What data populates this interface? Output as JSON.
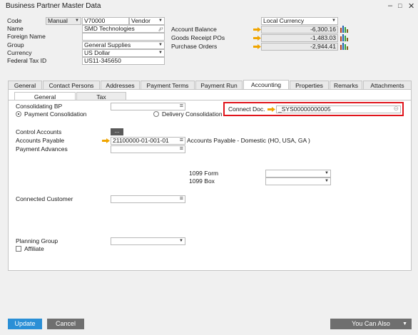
{
  "window": {
    "title": "Business Partner Master Data"
  },
  "header": {
    "code_label": "Code",
    "code_series": "Manual",
    "code_value": "V70000",
    "bp_type": "Vendor",
    "name_label": "Name",
    "name_value": "SMD Technologies",
    "foreign_name_label": "Foreign Name",
    "group_label": "Group",
    "group_value": "General Supplies",
    "currency_label": "Currency",
    "currency_value": "US Dollar",
    "tax_id_label": "Federal Tax ID",
    "tax_id_value": "US11-345650",
    "currency_mode": "Local Currency",
    "account_balance_label": "Account Balance",
    "account_balance_value": "-6,300.16",
    "goods_receipt_label": "Goods Receipt POs",
    "goods_receipt_value": "-1,483.03",
    "purchase_orders_label": "Purchase Orders",
    "purchase_orders_value": "-2,944.41"
  },
  "tabs": [
    {
      "label": "General"
    },
    {
      "label": "Contact Persons"
    },
    {
      "label": "Addresses"
    },
    {
      "label": "Payment Terms"
    },
    {
      "label": "Payment Run"
    },
    {
      "label": "Accounting"
    },
    {
      "label": "Properties"
    },
    {
      "label": "Remarks"
    },
    {
      "label": "Attachments"
    }
  ],
  "subtabs": [
    {
      "label": "General"
    },
    {
      "label": "Tax"
    }
  ],
  "accounting": {
    "consolidating_bp_label": "Consolidating BP",
    "payment_consolidation_label": "Payment Consolidation",
    "delivery_consolidation_label": "Delivery Consolidation",
    "connect_doc_label": "Connect Doc.",
    "connect_doc_value": "_SYS00000000005",
    "control_accounts_label": "Control Accounts",
    "control_accounts_button": "...",
    "accounts_payable_label": "Accounts Payable",
    "accounts_payable_value": "21100000-01-001-01",
    "accounts_payable_desc": "Accounts Payable - Domestic (HO, USA, GA )",
    "payment_advances_label": "Payment Advances",
    "form1099_label": "1099 Form",
    "box1099_label": "1099 Box",
    "connected_customer_label": "Connected Customer",
    "planning_group_label": "Planning Group",
    "affiliate_label": "Affiliate"
  },
  "footer": {
    "update_label": "Update",
    "cancel_label": "Cancel",
    "you_can_also_label": "You Can Also"
  },
  "colors": {
    "highlight_border": "#e0151c",
    "primary_button": "#2a8fd6",
    "secondary_button": "#6f6f6f",
    "arrow": "#f0a500"
  }
}
